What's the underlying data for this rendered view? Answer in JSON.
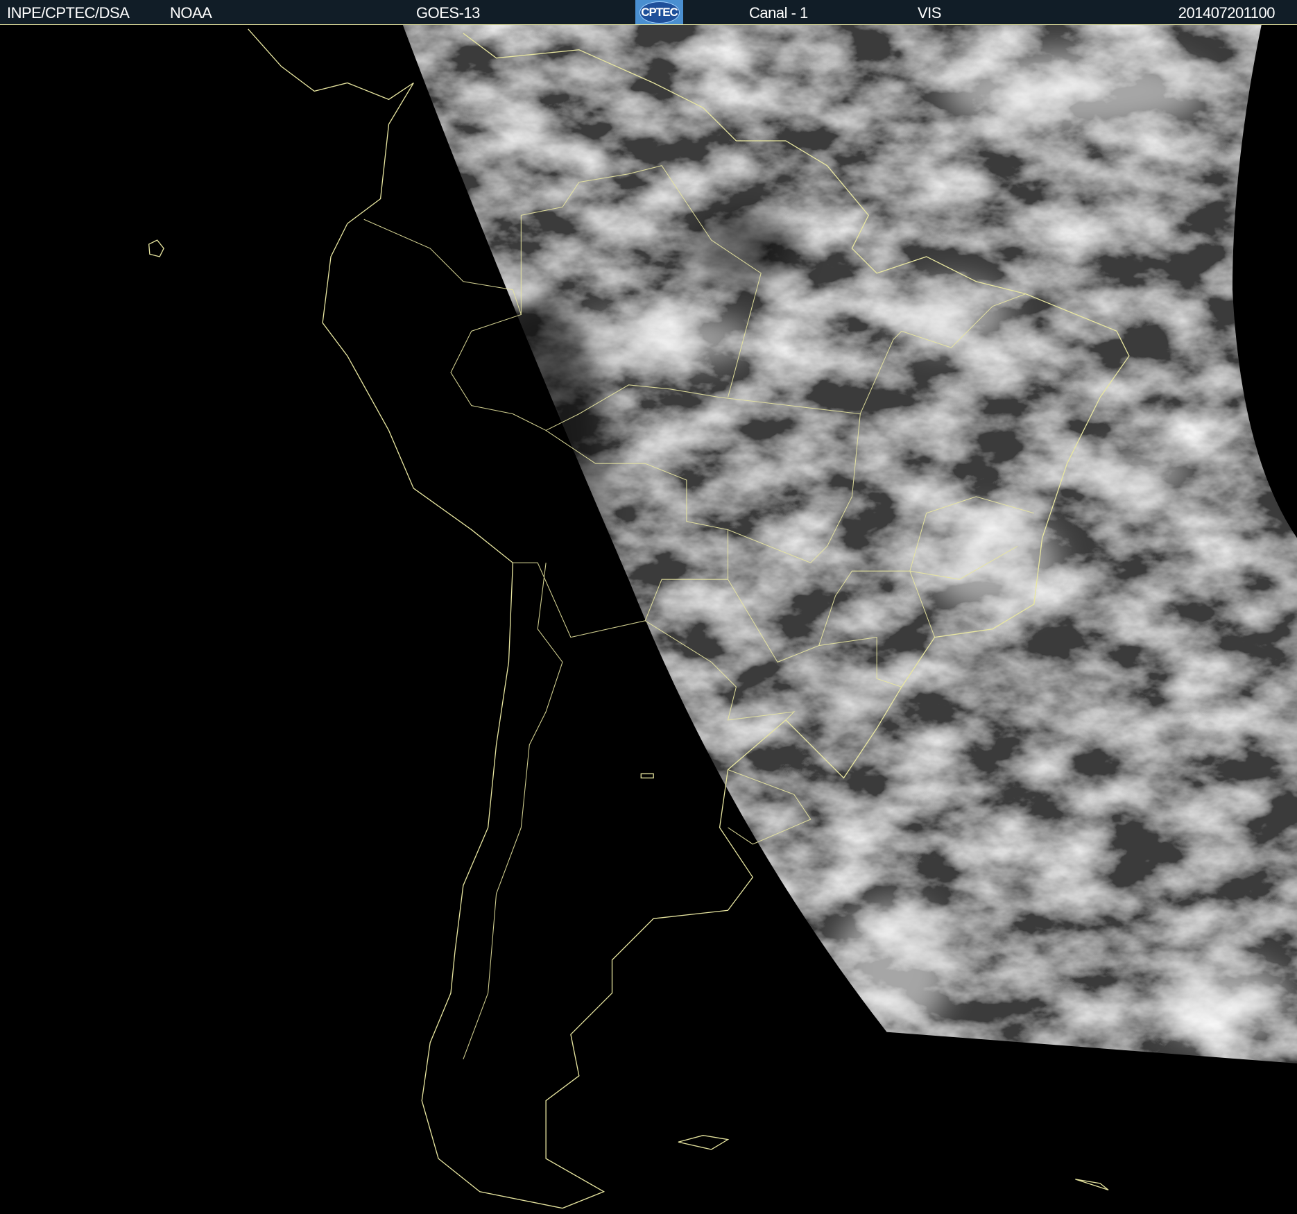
{
  "header": {
    "org": "INPE/CPTEC/DSA",
    "agency": "NOAA",
    "satellite": "GOES-13",
    "logo_text": "CPTEC",
    "channel": "Canal - 1",
    "band": "VIS",
    "timestamp": "201407201100"
  },
  "colors": {
    "header_bg": "#111d27",
    "coastline": "#e8e6a0",
    "background": "#000000"
  }
}
